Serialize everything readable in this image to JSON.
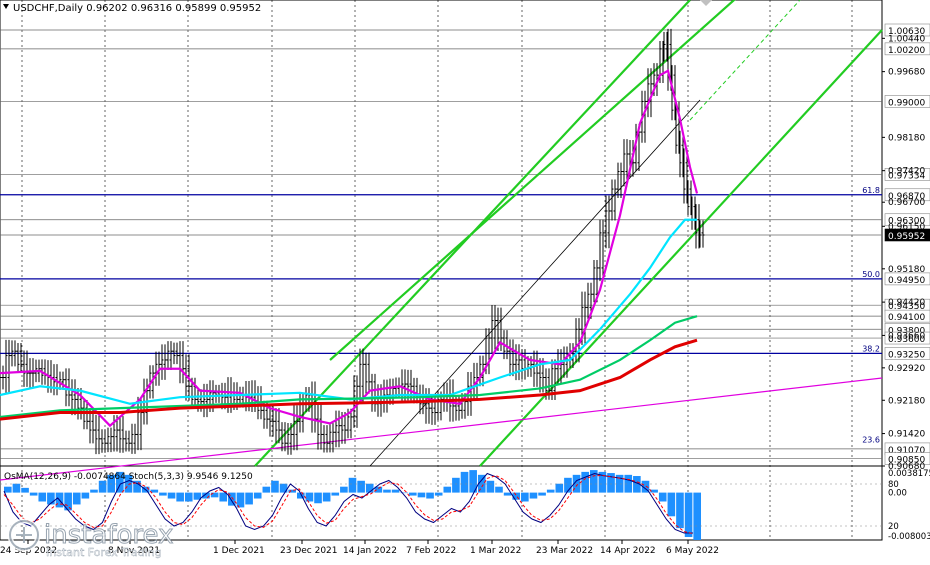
{
  "header": {
    "symbol_line": "USDCHF,Daily  0.96202 0.96316 0.95899 0.95952"
  },
  "indicator_header": {
    "label": "OsMA(12,26,9) -0.0074864  Stoch(5,3,3) 9.9546 9.1250"
  },
  "watermark": {
    "brand": "instaforex",
    "tagline": "Instant Forex Trading"
  },
  "colors": {
    "price_bars": "#000000",
    "ma_fast": "#e000e0",
    "ma_mid": "#00e5ff",
    "ma_slow": "#00cc66",
    "ma_long": "#e00000",
    "channel": "#22cc22",
    "level_lines": "#000080",
    "osma_bars": "#1e90ff",
    "stoch_main": "#000080",
    "stoch_signal": "#ff0000",
    "current_price_box": "#000000"
  },
  "chart_data": [
    {
      "type": "candlestick",
      "title": "USDCHF,Daily",
      "ylim": [
        0.9068,
        1.0063
      ],
      "y_ticks": [
        "1.00440",
        "0.99680",
        "0.98180",
        "0.97420",
        "0.96700",
        "0.96150",
        "0.95180",
        "0.94420",
        "0.93660",
        "0.92920",
        "0.92180",
        "0.91420",
        "0.90680"
      ],
      "levels": [
        {
          "label": "1.00630",
          "value": 1.0063
        },
        {
          "label": "1.00200",
          "value": 1.002
        },
        {
          "label": "0.99000",
          "value": 0.99
        },
        {
          "label": "0.97334",
          "value": 0.97334
        },
        {
          "label": "0.96870",
          "value": 0.9687
        },
        {
          "label": "0.96300",
          "value": 0.963
        },
        {
          "label": "0.95952",
          "value": 0.95952,
          "current": true
        },
        {
          "label": "0.94950",
          "value": 0.9495
        },
        {
          "label": "0.94350",
          "value": 0.9435
        },
        {
          "label": "0.94100",
          "value": 0.941
        },
        {
          "label": "0.93800",
          "value": 0.938
        },
        {
          "label": "0.93600",
          "value": 0.936
        },
        {
          "label": "0.93250",
          "value": 0.9325
        },
        {
          "label": "0.91070",
          "value": 0.9107
        },
        {
          "label": "0.90850",
          "value": 0.9085
        }
      ],
      "fib_labels": [
        {
          "label": "61.8",
          "value": 0.9687
        },
        {
          "label": "50.0",
          "value": 0.9495
        },
        {
          "label": "38.2",
          "value": 0.9325
        },
        {
          "label": "23.6",
          "value": 0.9117
        }
      ],
      "x_labels": [
        "24 Sep 2022",
        "8 Nov 2021",
        "1 Dec 2021",
        "23 Dec 2021",
        "14 Jan 2022",
        "7 Feb 2022",
        "1 Mar 2022",
        "23 Mar 2022",
        "14 Apr 2022",
        "6 May 2022"
      ],
      "close_path": [
        [
          0,
          0.927
        ],
        [
          6,
          0.932
        ],
        [
          12,
          0.933
        ],
        [
          18,
          0.93
        ],
        [
          24,
          0.928
        ],
        [
          30,
          0.928
        ],
        [
          36,
          0.929
        ],
        [
          42,
          0.9275
        ],
        [
          48,
          0.927
        ],
        [
          54,
          0.926
        ],
        [
          60,
          0.9265
        ],
        [
          66,
          0.923
        ],
        [
          72,
          0.922
        ],
        [
          78,
          0.92
        ],
        [
          84,
          0.917
        ],
        [
          90,
          0.915
        ],
        [
          96,
          0.913
        ],
        [
          102,
          0.912
        ],
        [
          108,
          0.9135
        ],
        [
          114,
          0.915
        ],
        [
          120,
          0.913
        ],
        [
          126,
          0.912
        ],
        [
          132,
          0.914
        ],
        [
          138,
          0.919
        ],
        [
          144,
          0.924
        ],
        [
          150,
          0.928
        ],
        [
          156,
          0.93
        ],
        [
          162,
          0.931
        ],
        [
          168,
          0.933
        ],
        [
          174,
          0.932
        ],
        [
          180,
          0.929
        ],
        [
          186,
          0.925
        ],
        [
          192,
          0.922
        ],
        [
          198,
          0.9215
        ],
        [
          204,
          0.922
        ],
        [
          210,
          0.9235
        ],
        [
          216,
          0.923
        ],
        [
          222,
          0.9225
        ],
        [
          228,
          0.9235
        ],
        [
          234,
          0.922
        ],
        [
          240,
          0.923
        ],
        [
          246,
          0.9225
        ],
        [
          252,
          0.923
        ],
        [
          258,
          0.9195
        ],
        [
          264,
          0.9175
        ],
        [
          270,
          0.917
        ],
        [
          276,
          0.915
        ],
        [
          282,
          0.912
        ],
        [
          288,
          0.914
        ],
        [
          294,
          0.917
        ],
        [
          300,
          0.921
        ],
        [
          306,
          0.923
        ],
        [
          312,
          0.9175
        ],
        [
          318,
          0.914
        ],
        [
          324,
          0.912
        ],
        [
          330,
          0.9145
        ],
        [
          336,
          0.916
        ],
        [
          342,
          0.915
        ],
        [
          348,
          0.918
        ],
        [
          354,
          0.925
        ],
        [
          360,
          0.93
        ],
        [
          366,
          0.926
        ],
        [
          372,
          0.921
        ],
        [
          378,
          0.9225
        ],
        [
          384,
          0.923
        ],
        [
          390,
          0.9245
        ],
        [
          396,
          0.925
        ],
        [
          402,
          0.9255
        ],
        [
          408,
          0.925
        ],
        [
          414,
          0.923
        ],
        [
          420,
          0.921
        ],
        [
          426,
          0.92
        ],
        [
          432,
          0.919
        ],
        [
          438,
          0.922
        ],
        [
          444,
          0.923
        ],
        [
          450,
          0.9205
        ],
        [
          456,
          0.9195
        ],
        [
          462,
          0.9215
        ],
        [
          468,
          0.925
        ],
        [
          474,
          0.927
        ],
        [
          480,
          0.93
        ],
        [
          486,
          0.936
        ],
        [
          492,
          0.94
        ],
        [
          498,
          0.936
        ],
        [
          504,
          0.933
        ],
        [
          510,
          0.93
        ],
        [
          516,
          0.931
        ],
        [
          522,
          0.929
        ],
        [
          528,
          0.93
        ],
        [
          534,
          0.928
        ],
        [
          540,
          0.927
        ],
        [
          546,
          0.924
        ],
        [
          552,
          0.929
        ],
        [
          558,
          0.93
        ],
        [
          564,
          0.931
        ],
        [
          570,
          0.933
        ],
        [
          576,
          0.938
        ],
        [
          582,
          0.943
        ],
        [
          588,
          0.946
        ],
        [
          594,
          0.952
        ],
        [
          600,
          0.96
        ],
        [
          606,
          0.965
        ],
        [
          612,
          0.97
        ],
        [
          618,
          0.974
        ],
        [
          624,
          0.978
        ],
        [
          630,
          0.976
        ],
        [
          636,
          0.983
        ],
        [
          642,
          0.99
        ],
        [
          648,
          0.994
        ],
        [
          654,
          0.996
        ],
        [
          660,
          1.002
        ],
        [
          664,
          1.003
        ],
        [
          668,
          0.996
        ],
        [
          672,
          0.988
        ],
        [
          676,
          0.98
        ],
        [
          680,
          0.976
        ],
        [
          684,
          0.97
        ],
        [
          688,
          0.966
        ],
        [
          692,
          0.963
        ],
        [
          696,
          0.96
        ],
        [
          700,
          0.95952
        ]
      ],
      "series": [
        {
          "name": "",
          "color_key": "ma_fast",
          "path": [
            [
              0,
              0.928
            ],
            [
              40,
              0.9285
            ],
            [
              80,
              0.923
            ],
            [
              110,
              0.916
            ],
            [
              140,
              0.922
            ],
            [
              160,
              0.929
            ],
            [
              180,
              0.929
            ],
            [
              200,
              0.924
            ],
            [
              240,
              0.9235
            ],
            [
              270,
              0.92
            ],
            [
              300,
              0.918
            ],
            [
              330,
              0.9165
            ],
            [
              350,
              0.919
            ],
            [
              370,
              0.924
            ],
            [
              400,
              0.925
            ],
            [
              430,
              0.922
            ],
            [
              460,
              0.921
            ],
            [
              480,
              0.927
            ],
            [
              500,
              0.935
            ],
            [
              530,
              0.931
            ],
            [
              560,
              0.93
            ],
            [
              580,
              0.935
            ],
            [
              600,
              0.947
            ],
            [
              620,
              0.964
            ],
            [
              640,
              0.985
            ],
            [
              660,
              0.996
            ],
            [
              668,
              0.997
            ],
            [
              680,
              0.986
            ],
            [
              690,
              0.975
            ],
            [
              697,
              0.969
            ]
          ]
        },
        {
          "name": "",
          "color_key": "ma_mid",
          "path": [
            [
              0,
              0.923
            ],
            [
              40,
              0.925
            ],
            [
              80,
              0.924
            ],
            [
              130,
              0.921
            ],
            [
              180,
              0.9225
            ],
            [
              240,
              0.923
            ],
            [
              300,
              0.9235
            ],
            [
              350,
              0.922
            ],
            [
              400,
              0.923
            ],
            [
              450,
              0.923
            ],
            [
              500,
              0.927
            ],
            [
              540,
              0.93
            ],
            [
              570,
              0.931
            ],
            [
              600,
              0.938
            ],
            [
              630,
              0.946
            ],
            [
              650,
              0.952
            ],
            [
              670,
              0.959
            ],
            [
              685,
              0.963
            ],
            [
              697,
              0.963
            ]
          ]
        },
        {
          "name": "",
          "color_key": "ma_slow",
          "path": [
            [
              0,
              0.918
            ],
            [
              60,
              0.9195
            ],
            [
              120,
              0.92
            ],
            [
              180,
              0.9205
            ],
            [
              240,
              0.921
            ],
            [
              300,
              0.922
            ],
            [
              360,
              0.9222
            ],
            [
              420,
              0.9225
            ],
            [
              480,
              0.923
            ],
            [
              540,
              0.9245
            ],
            [
              580,
              0.9265
            ],
            [
              620,
              0.931
            ],
            [
              650,
              0.9355
            ],
            [
              675,
              0.9395
            ],
            [
              697,
              0.941
            ]
          ]
        },
        {
          "name": "",
          "color_key": "ma_long",
          "path": [
            [
              0,
              0.9175
            ],
            [
              60,
              0.919
            ],
            [
              120,
              0.919
            ],
            [
              180,
              0.92
            ],
            [
              240,
              0.9205
            ],
            [
              300,
              0.921
            ],
            [
              360,
              0.9212
            ],
            [
              420,
              0.9215
            ],
            [
              480,
              0.922
            ],
            [
              540,
              0.923
            ],
            [
              580,
              0.924
            ],
            [
              620,
              0.927
            ],
            [
              650,
              0.931
            ],
            [
              675,
              0.934
            ],
            [
              697,
              0.9355
            ]
          ]
        }
      ]
    },
    {
      "type": "bar",
      "title": "OsMA(12,26,9) Stoch(5,3,3)",
      "y_ticks": [
        "0.0038175",
        "80",
        "0.00",
        "20",
        "-0.008003"
      ],
      "stoch_levels": [
        80,
        20
      ],
      "osma_values": [
        0.001,
        0.0015,
        0.0008,
        -0.0005,
        -0.0015,
        -0.002,
        -0.0025,
        -0.003,
        -0.002,
        -0.001,
        0.0005,
        0.002,
        0.003,
        0.0035,
        0.003,
        0.002,
        0.001,
        0.0005,
        -0.0005,
        -0.001,
        -0.0015,
        -0.0015,
        -0.0012,
        -0.001,
        -0.0008,
        -0.0015,
        -0.0022,
        -0.0025,
        -0.002,
        -0.001,
        0.001,
        0.002,
        0.0015,
        0.0005,
        -0.001,
        -0.0015,
        -0.0018,
        -0.0015,
        -0.0005,
        0.001,
        0.0025,
        0.002,
        0.0015,
        0.001,
        0.0005,
        0.0005,
        0.0,
        -0.0005,
        -0.0008,
        -0.001,
        -0.0005,
        0.001,
        0.0025,
        0.0035,
        0.0038,
        0.003,
        0.002,
        0.001,
        -0.0005,
        -0.0012,
        -0.0015,
        -0.001,
        -0.0005,
        0.0005,
        0.0015,
        0.0025,
        0.003,
        0.0035,
        0.0038,
        0.0035,
        0.0033,
        0.003,
        0.003,
        0.0028,
        0.002,
        0.0005,
        -0.0015,
        -0.004,
        -0.006,
        -0.0075,
        -0.008
      ],
      "stoch_main": [
        70,
        40,
        25,
        20,
        35,
        50,
        60,
        45,
        30,
        20,
        15,
        25,
        55,
        80,
        85,
        80,
        70,
        50,
        30,
        20,
        25,
        40,
        60,
        70,
        75,
        65,
        45,
        20,
        15,
        20,
        35,
        60,
        80,
        70,
        45,
        25,
        20,
        35,
        55,
        65,
        60,
        70,
        80,
        85,
        75,
        60,
        40,
        30,
        25,
        35,
        45,
        40,
        55,
        80,
        95,
        90,
        80,
        60,
        40,
        30,
        25,
        35,
        50,
        70,
        85,
        90,
        95,
        92,
        90,
        88,
        85,
        80,
        70,
        50,
        30,
        15,
        10,
        9.95
      ],
      "stoch_signal": [
        65,
        50,
        32,
        25,
        30,
        42,
        52,
        50,
        38,
        25,
        18,
        20,
        40,
        65,
        80,
        82,
        75,
        60,
        40,
        25,
        22,
        32,
        50,
        64,
        72,
        68,
        52,
        32,
        20,
        18,
        27,
        48,
        70,
        73,
        55,
        35,
        24,
        28,
        45,
        58,
        62,
        66,
        75,
        82,
        80,
        68,
        50,
        36,
        28,
        30,
        40,
        42,
        48,
        68,
        88,
        92,
        85,
        68,
        50,
        35,
        28,
        30,
        42,
        60,
        78,
        88,
        92,
        92,
        90,
        88,
        86,
        82,
        75,
        58,
        38,
        22,
        12,
        9.13
      ]
    }
  ]
}
